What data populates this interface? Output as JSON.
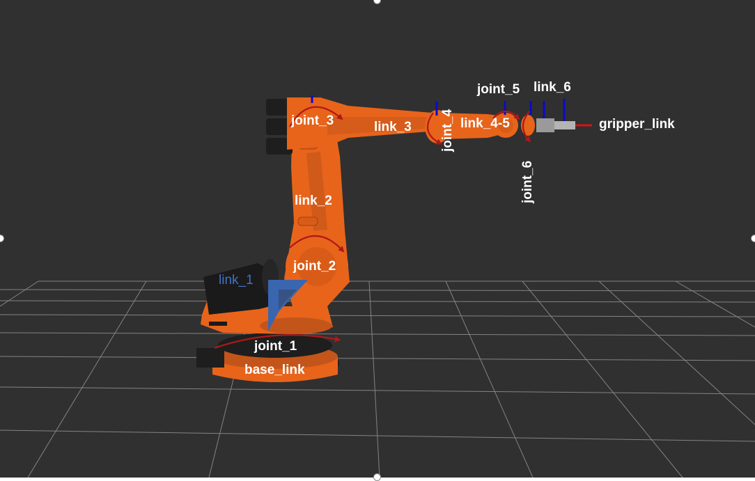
{
  "colors": {
    "background": "#303030",
    "grid": "#a0a0a0",
    "robot_orange": "#e8641b",
    "robot_dark": "#1e1e1e",
    "rotation_arrow": "#b01818",
    "axis_blue": "#0a0ac8",
    "axis_red": "#e01010",
    "label_white": "#ffffff",
    "label_blue": "#4472c4",
    "frame_marker": "#3a66b0"
  },
  "labels": {
    "base_link": "base_link",
    "joint_1": "joint_1",
    "link_1": "link_1",
    "joint_2": "joint_2",
    "link_2": "link_2",
    "joint_3": "joint_3",
    "link_3": "link_3",
    "joint_4": "joint_4",
    "link_4_5": "link_4-5",
    "joint_5": "joint_5",
    "link_6": "link_6",
    "joint_6": "joint_6",
    "gripper_link": "gripper_link"
  }
}
